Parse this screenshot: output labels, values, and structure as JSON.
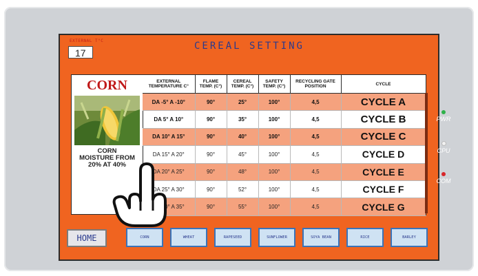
{
  "screen": {
    "title": "CEREAL SETTING",
    "external_temp_label": "EXTERNAL T°C",
    "external_temp_value": "17"
  },
  "crop": {
    "name": "CORN",
    "info": "CORN\nMOISTURE FROM\n20% AT 40%"
  },
  "table": {
    "headers": [
      "EXTERNAL TEMPERATURE C°",
      "FLAME TEMP. (C°)",
      "CEREAL TEMP. (C°)",
      "SAFETY TEMP. (C°)",
      "RECYCLING GATE POSITION",
      "CYCLE"
    ],
    "rows": [
      {
        "ext": "DA -5° A -10°",
        "flame": "90°",
        "cereal": "25°",
        "safety": "100°",
        "gate": "4,5",
        "cycle": "CYCLE A",
        "highlight": true,
        "active": true
      },
      {
        "ext": "DA 5° A 10°",
        "flame": "90°",
        "cereal": "35°",
        "safety": "100°",
        "gate": "4,5",
        "cycle": "CYCLE B",
        "highlight": false,
        "active": true
      },
      {
        "ext": "DA 10° A 15°",
        "flame": "90°",
        "cereal": "40°",
        "safety": "100°",
        "gate": "4,5",
        "cycle": "CYCLE C",
        "highlight": true,
        "active": true
      },
      {
        "ext": "DA 15° A 20°",
        "flame": "90°",
        "cereal": "45°",
        "safety": "100°",
        "gate": "4,5",
        "cycle": "CYCLE D",
        "highlight": false,
        "active": false
      },
      {
        "ext": "DA 20° A 25°",
        "flame": "90°",
        "cereal": "48°",
        "safety": "100°",
        "gate": "4,5",
        "cycle": "CYCLE E",
        "highlight": true,
        "active": false
      },
      {
        "ext": "DA 25° A 30°",
        "flame": "90°",
        "cereal": "52°",
        "safety": "100°",
        "gate": "4,5",
        "cycle": "CYCLE F",
        "highlight": false,
        "active": false
      },
      {
        "ext": "DA 30° A 35°",
        "flame": "90°",
        "cereal": "55°",
        "safety": "100°",
        "gate": "4,5",
        "cycle": "CYCLE G",
        "highlight": true,
        "active": false
      }
    ]
  },
  "nav": {
    "home": "HOME",
    "tabs": [
      "CORN",
      "WHEAT",
      "RAPESEED",
      "SUNFLOWER",
      "SOYA BEAN",
      "RICE",
      "BARLEY"
    ]
  },
  "indicators": [
    {
      "label": "PWR",
      "color": "#2fb24a"
    },
    {
      "label": "CPU",
      "color": "#f2f2f2"
    },
    {
      "label": "COM",
      "color": "#d8262a"
    }
  ],
  "colors": {
    "screen_bg": "#f06420",
    "row_highlight": "#f5a27e",
    "crop_name": "#c01a1a",
    "title": "#2a3a8e"
  }
}
